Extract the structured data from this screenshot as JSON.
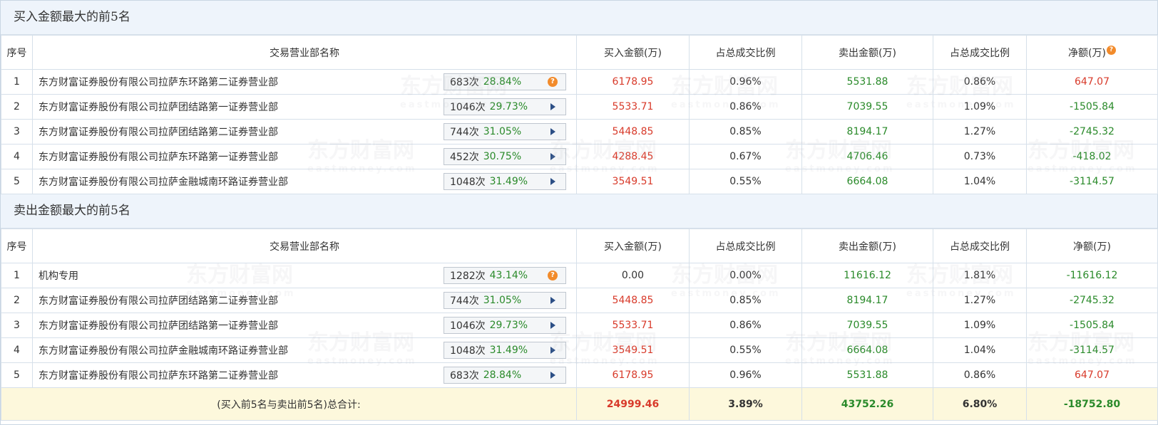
{
  "buy_section": {
    "title": "买入金额最大的前5名",
    "headers": [
      "序号",
      "交易营业部名称",
      "买入金额(万)",
      "占总成交比例",
      "卖出金额(万)",
      "占总成交比例",
      "净额(万)"
    ],
    "rows": [
      {
        "idx": "1",
        "name": "东方财富证券股份有限公司拉萨东环路第二证券营业部",
        "count": "683次",
        "pct": "28.84%",
        "icon": "question-icon",
        "buy": "6178.95",
        "buy_ratio": "0.96%",
        "sell": "5531.88",
        "sell_ratio": "0.86%",
        "net": "647.07",
        "net_sign": "pos"
      },
      {
        "idx": "2",
        "name": "东方财富证券股份有限公司拉萨团结路第一证券营业部",
        "count": "1046次",
        "pct": "29.73%",
        "icon": "play-arrow-icon",
        "buy": "5533.71",
        "buy_ratio": "0.86%",
        "sell": "7039.55",
        "sell_ratio": "1.09%",
        "net": "-1505.84",
        "net_sign": "neg"
      },
      {
        "idx": "3",
        "name": "东方财富证券股份有限公司拉萨团结路第二证券营业部",
        "count": "744次",
        "pct": "31.05%",
        "icon": "play-arrow-icon",
        "buy": "5448.85",
        "buy_ratio": "0.85%",
        "sell": "8194.17",
        "sell_ratio": "1.27%",
        "net": "-2745.32",
        "net_sign": "neg"
      },
      {
        "idx": "4",
        "name": "东方财富证券股份有限公司拉萨东环路第一证券营业部",
        "count": "452次",
        "pct": "30.75%",
        "icon": "play-arrow-icon",
        "buy": "4288.45",
        "buy_ratio": "0.67%",
        "sell": "4706.46",
        "sell_ratio": "0.73%",
        "net": "-418.02",
        "net_sign": "neg"
      },
      {
        "idx": "5",
        "name": "东方财富证券股份有限公司拉萨金融城南环路证券营业部",
        "count": "1048次",
        "pct": "31.49%",
        "icon": "play-arrow-icon",
        "buy": "3549.51",
        "buy_ratio": "0.55%",
        "sell": "6664.08",
        "sell_ratio": "1.04%",
        "net": "-3114.57",
        "net_sign": "neg"
      }
    ]
  },
  "sell_section": {
    "title": "卖出金额最大的前5名",
    "headers": [
      "序号",
      "交易营业部名称",
      "买入金额(万)",
      "占总成交比例",
      "卖出金额(万)",
      "占总成交比例",
      "净额(万)"
    ],
    "rows": [
      {
        "idx": "1",
        "name": "机构专用",
        "count": "1282次",
        "pct": "43.14%",
        "icon": "question-icon",
        "buy": "0.00",
        "buy_ratio": "0.00%",
        "sell": "11616.12",
        "sell_ratio": "1.81%",
        "net": "-11616.12",
        "net_sign": "neg",
        "buy_zero": true
      },
      {
        "idx": "2",
        "name": "东方财富证券股份有限公司拉萨团结路第二证券营业部",
        "count": "744次",
        "pct": "31.05%",
        "icon": "play-arrow-icon",
        "buy": "5448.85",
        "buy_ratio": "0.85%",
        "sell": "8194.17",
        "sell_ratio": "1.27%",
        "net": "-2745.32",
        "net_sign": "neg"
      },
      {
        "idx": "3",
        "name": "东方财富证券股份有限公司拉萨团结路第一证券营业部",
        "count": "1046次",
        "pct": "29.73%",
        "icon": "play-arrow-icon",
        "buy": "5533.71",
        "buy_ratio": "0.86%",
        "sell": "7039.55",
        "sell_ratio": "1.09%",
        "net": "-1505.84",
        "net_sign": "neg"
      },
      {
        "idx": "4",
        "name": "东方财富证券股份有限公司拉萨金融城南环路证券营业部",
        "count": "1048次",
        "pct": "31.49%",
        "icon": "play-arrow-icon",
        "buy": "3549.51",
        "buy_ratio": "0.55%",
        "sell": "6664.08",
        "sell_ratio": "1.04%",
        "net": "-3114.57",
        "net_sign": "neg"
      },
      {
        "idx": "5",
        "name": "东方财富证券股份有限公司拉萨东环路第二证券营业部",
        "count": "683次",
        "pct": "28.84%",
        "icon": "play-arrow-icon",
        "buy": "6178.95",
        "buy_ratio": "0.96%",
        "sell": "5531.88",
        "sell_ratio": "0.86%",
        "net": "647.07",
        "net_sign": "pos"
      }
    ],
    "total": {
      "label": "(买入前5名与卖出前5名)总合计:",
      "buy": "24999.46",
      "buy_ratio": "3.89%",
      "sell": "43752.26",
      "sell_ratio": "6.80%",
      "net": "-18752.80"
    }
  },
  "watermark": {
    "cn": "东方财富网",
    "en": "eastmoney.com"
  },
  "colors": {
    "buy": "#d83a2a",
    "sell": "#2a8a2a",
    "total_bg": "#fdf8dc",
    "title_bg": "#eef4fb",
    "question_icon": "#f28b2b",
    "arrow_icon": "#2c4f86"
  }
}
